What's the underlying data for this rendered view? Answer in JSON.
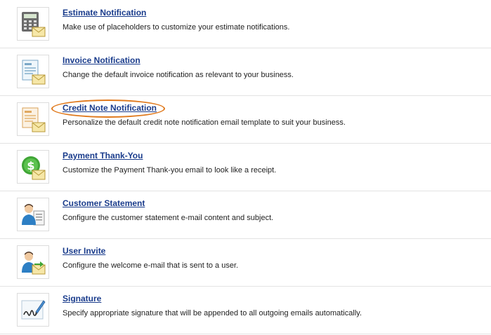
{
  "items": [
    {
      "title": "Estimate Notification",
      "description": "Make use of placeholders to customize your estimate notifications.",
      "icon": "calculator-envelope-icon"
    },
    {
      "title": "Invoice Notification",
      "description": "Change the default invoice notification as relevant to your business.",
      "icon": "invoice-envelope-icon"
    },
    {
      "title": "Credit Note Notification",
      "description": "Personalize the default credit note notification email template to suit your business.",
      "icon": "credit-note-envelope-icon"
    },
    {
      "title": "Payment Thank-You",
      "description": "Customize the Payment Thank-you email to look like a receipt.",
      "icon": "dollar-envelope-icon"
    },
    {
      "title": "Customer Statement",
      "description": "Configure the customer statement e-mail content and subject.",
      "icon": "customer-statement-icon"
    },
    {
      "title": "User Invite",
      "description": "Configure the welcome e-mail that is sent to a user.",
      "icon": "user-invite-icon"
    },
    {
      "title": "Signature",
      "description": "Specify appropriate signature that will be appended to all outgoing emails automatically.",
      "icon": "signature-pen-icon"
    }
  ],
  "highlight_color": "#e07a1e",
  "link_color": "#1a3c8c"
}
